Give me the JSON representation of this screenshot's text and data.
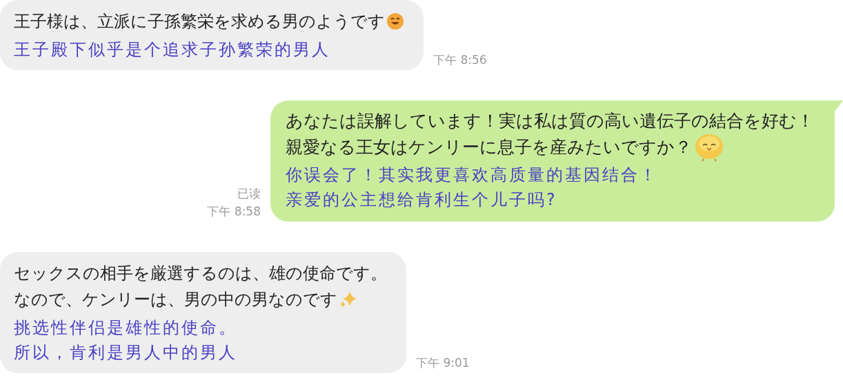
{
  "messages": [
    {
      "kind": "incoming",
      "lines": [
        "王子様は、立派に子孫繁栄を求める男のようです"
      ],
      "emoji": {
        "kind": "smile"
      },
      "translation": [
        "王子殿下似乎是个追求子孙繁荣的男人"
      ],
      "time": "下午 8:56"
    },
    {
      "kind": "outgoing",
      "lines": [
        "あなたは誤解しています！実は私は質の高い遺伝子の結合を好む！",
        "親愛なる王女はケンリーに息子を産みたいですか？"
      ],
      "emoji": {
        "kind": "chick"
      },
      "translation": [
        "你误会了！其实我更喜欢高质量的基因结合！",
        "亲爱的公主想给肯利生个儿子吗?"
      ],
      "read": "已读",
      "time": "下午 8:58"
    },
    {
      "kind": "incoming",
      "lines": [
        "セックスの相手を厳選するのは、雄の使命です。",
        "なので、ケンリーは、男の中の男なのです"
      ],
      "emoji": {
        "kind": "sparkle"
      },
      "translation": [
        "挑选性伴侣是雄性的使命。",
        "所以，肯利是男人中的男人"
      ],
      "time": "下午 9:01"
    }
  ]
}
